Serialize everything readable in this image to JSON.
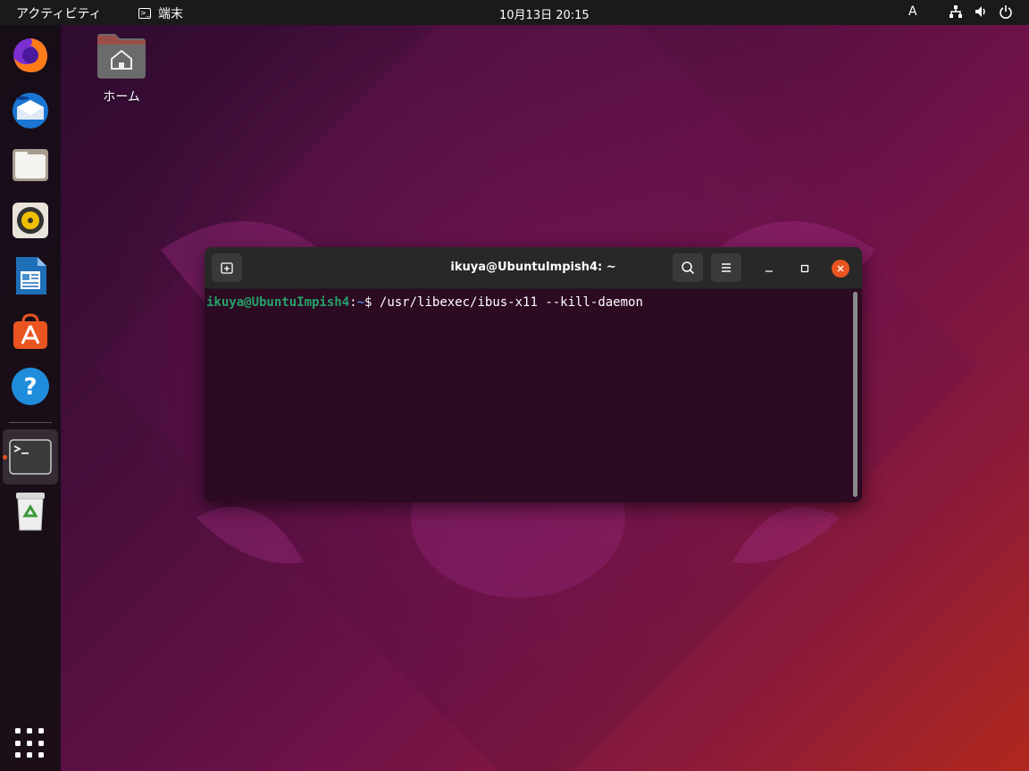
{
  "topbar": {
    "activities": "アクティビティ",
    "app_name": "端末",
    "clock": "10月13日  20:15",
    "input_method": "A"
  },
  "dock": {
    "items": [
      {
        "name": "firefox"
      },
      {
        "name": "thunderbird"
      },
      {
        "name": "files"
      },
      {
        "name": "rhythmbox"
      },
      {
        "name": "libreoffice-writer"
      },
      {
        "name": "ubuntu-software"
      },
      {
        "name": "help"
      },
      {
        "name": "terminal",
        "running": true
      },
      {
        "name": "trash"
      }
    ]
  },
  "desktop": {
    "home_label": "ホーム"
  },
  "terminal": {
    "title": "ikuya@UbuntuImpish4: ~",
    "prompt_user": "ikuya@UbuntuImpish4",
    "prompt_sep": ":",
    "prompt_path": "~",
    "prompt_symbol": "$ ",
    "command": "/usr/libexec/ibus-x11 --kill-daemon"
  },
  "colors": {
    "accent": "#e95420",
    "terminal_bg": "#2c0a22",
    "prompt_green": "#26a269",
    "prompt_blue": "#5a7fd6"
  }
}
